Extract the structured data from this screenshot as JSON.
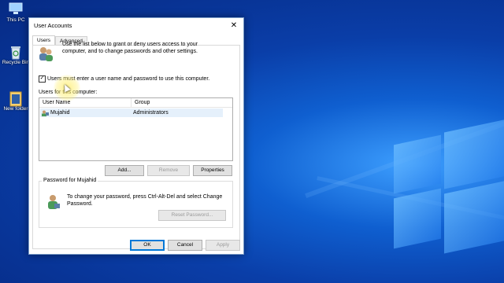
{
  "desktop": {
    "icons": [
      {
        "name": "This PC",
        "icon": "computer-icon"
      },
      {
        "name": "Recycle Bin",
        "icon": "recycle-bin-icon"
      },
      {
        "name": "New folder",
        "icon": "folder-icon"
      }
    ]
  },
  "dialog": {
    "title": "User Accounts",
    "close_glyph": "✕",
    "tabs": [
      {
        "label": "Users",
        "active": true
      },
      {
        "label": "Advanced",
        "active": false
      }
    ],
    "intro_text": "Use the list below to grant or deny users access to your computer, and to change passwords and other settings.",
    "require_login": {
      "label": "Users must enter a user name and password to use this computer.",
      "checked": true
    },
    "users_label": "Users for this computer:",
    "columns": [
      "User Name",
      "Group"
    ],
    "users": [
      {
        "name": "Mujahid",
        "group": "Administrators"
      }
    ],
    "buttons": {
      "add": "Add...",
      "remove": "Remove",
      "properties": "Properties",
      "reset_password": "Reset Password...",
      "ok": "OK",
      "cancel": "Cancel",
      "apply": "Apply"
    },
    "password_group": {
      "title": "Password for Mujahid",
      "text": "To change your password, press Ctrl-Alt-Del and select Change Password."
    }
  },
  "colors": {
    "accent": "#0078d7",
    "selection": "#e5f0fb",
    "desktop": "#0a3ea8"
  }
}
